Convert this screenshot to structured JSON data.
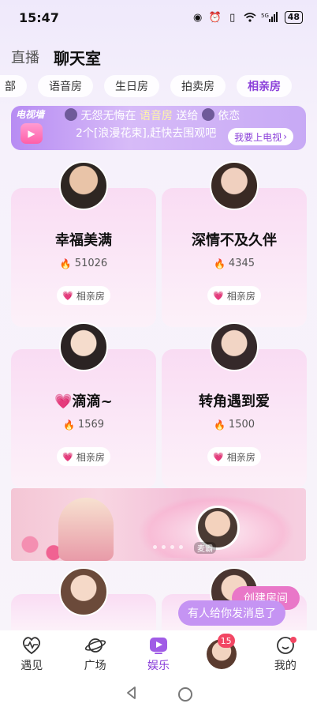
{
  "status_bar": {
    "time": "15:47",
    "signal": "5G",
    "battery": "48"
  },
  "top_tabs": {
    "live": "直播",
    "chat": "聊天室"
  },
  "categories": [
    "部",
    "语音房",
    "生日房",
    "拍卖房",
    "相亲房"
  ],
  "tv_banner": {
    "logo": "电视墙",
    "line1_prefix": "无怨无悔在",
    "line1_room": "语音房",
    "line1_send": "送给",
    "line1_target": "依恋",
    "line2": "2个[浪漫花束],赶快去围观吧",
    "button": "我要上电视"
  },
  "rooms": [
    {
      "title": "幸福美满",
      "heat": "51026",
      "tag": "相亲房"
    },
    {
      "title": "深情不及久伴",
      "heat": "4345",
      "tag": "相亲房"
    },
    {
      "title": "💗滴滴~",
      "heat": "1569",
      "tag": "相亲房"
    },
    {
      "title": "转角遇到爱",
      "heat": "1500",
      "tag": "相亲房"
    }
  ],
  "promo": {
    "name": "麦霸"
  },
  "create_room": "创建房间",
  "toast": "有人给你发消息了",
  "nav": {
    "items": [
      {
        "label": "遇见"
      },
      {
        "label": "广场"
      },
      {
        "label": "娱乐"
      },
      {
        "label": ""
      },
      {
        "label": "我的"
      }
    ],
    "badge": "15"
  },
  "colors": {
    "accent": "#8a3fd9",
    "card": "#f9dcf3",
    "badge": "#f24663",
    "create": "#e977c8"
  }
}
